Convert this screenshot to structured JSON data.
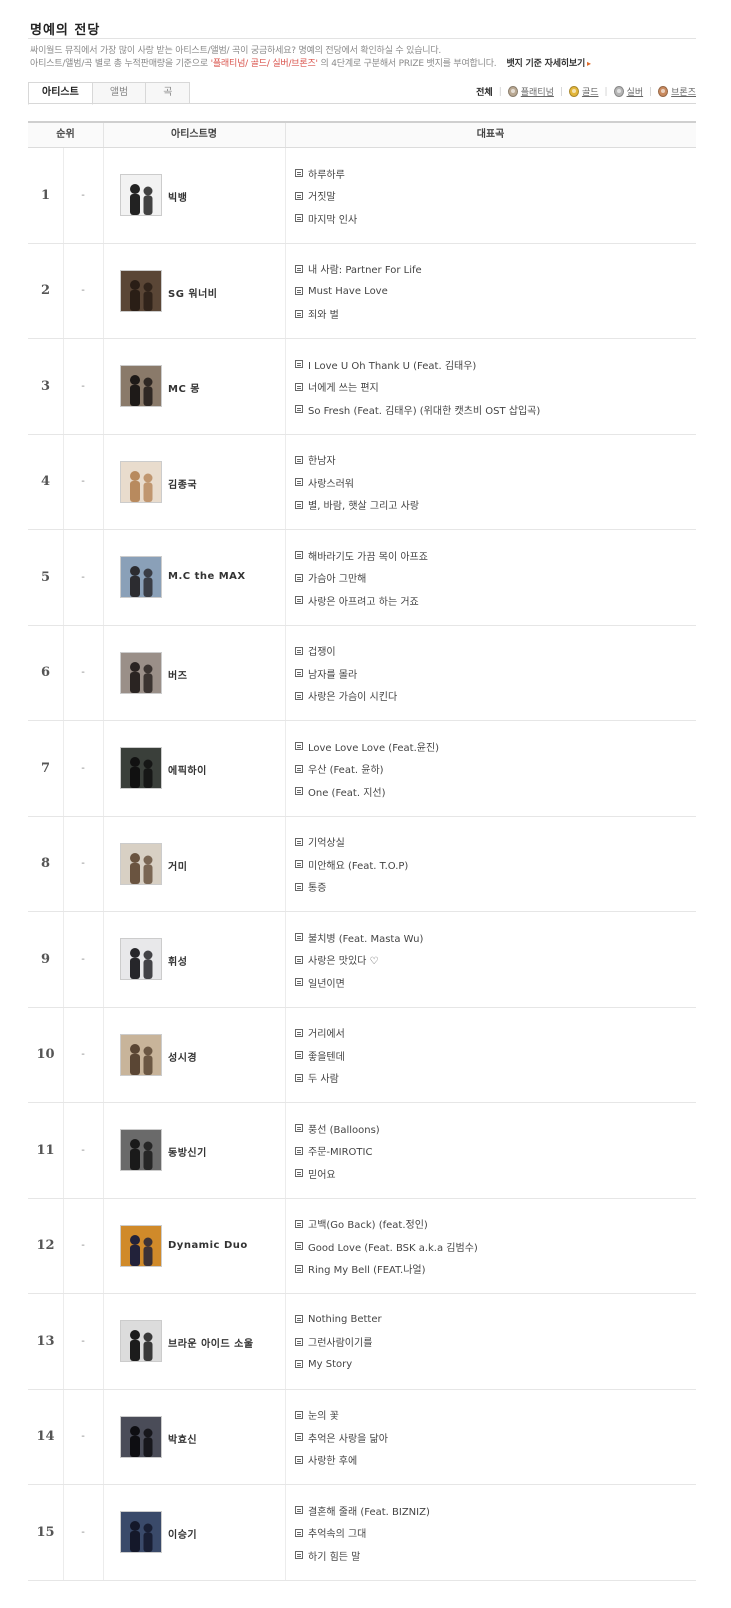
{
  "page": {
    "title": "명예의 전당",
    "desc_line1": "싸이월드 뮤직에서 가장 많이 사랑 받는 아티스트/앨범/ 곡이 궁금하세요? 명예의 전당에서 확인하실 수 있습니다.",
    "desc_line2_a": "아티스트/앨범/곡 별로 총 누적판매량을 기준으로 ",
    "desc_line2_hl": "'플래티넘/ 골드/ 실버/브론즈'",
    "desc_line2_b": " 의 4단계로 구분해서 PRIZE 뱃지를 부여합니다.",
    "badge_link": "뱃지 기준 자세히보기",
    "badge_link_arrow": "▸"
  },
  "tabs": [
    {
      "label": "아티스트",
      "active": true
    },
    {
      "label": "앨범",
      "active": false
    },
    {
      "label": "곡",
      "active": false
    }
  ],
  "filters": {
    "all": "전체",
    "platinum": "플래티넘",
    "gold": "골드",
    "silver": "실버",
    "bronze": "브론즈",
    "colors": {
      "platinum": "#b9a892",
      "gold": "#e3b63a",
      "silver": "#b5b5b5",
      "bronze": "#c98a5e"
    }
  },
  "table": {
    "headers": {
      "rank": "순위",
      "artist": "아티스트명",
      "songs": "대표곡"
    },
    "rows": [
      {
        "rank": "1",
        "change": "-",
        "artist": "빅뱅",
        "songs": [
          "하루하루",
          "거짓말",
          "마지막 인사"
        ],
        "photo": {
          "bg": "#f2f2f2",
          "fg": "#222222"
        }
      },
      {
        "rank": "2",
        "change": "-",
        "artist": "SG 워너비",
        "songs": [
          "내 사람: Partner For Life",
          "Must Have Love",
          "죄와 벌"
        ],
        "photo": {
          "bg": "#5a4636",
          "fg": "#2a1e16"
        }
      },
      {
        "rank": "3",
        "change": "-",
        "artist": "MC 몽",
        "songs": [
          "I Love U Oh Thank U (Feat. 김태우)",
          "너에게 쓰는 편지",
          "So Fresh (Feat. 김태우) (위대한 캣츠비 OST 삽입곡)"
        ],
        "photo": {
          "bg": "#8a7a6a",
          "fg": "#1e1a18"
        }
      },
      {
        "rank": "4",
        "change": "-",
        "artist": "김종국",
        "songs": [
          "한남자",
          "사랑스러워",
          "별, 바람, 햇살 그리고 사랑"
        ],
        "photo": {
          "bg": "#e9dccd",
          "fg": "#b88a5e"
        }
      },
      {
        "rank": "5",
        "change": "-",
        "artist": "M.C the MAX",
        "songs": [
          "해바라기도 가끔 목이 아프죠",
          "가슴아 그만해",
          "사랑은 아프려고 하는 거죠"
        ],
        "photo": {
          "bg": "#8aa0b8",
          "fg": "#2c2c30"
        }
      },
      {
        "rank": "6",
        "change": "-",
        "artist": "버즈",
        "songs": [
          "겁쟁이",
          "남자를 몰라",
          "사랑은 가슴이 시킨다"
        ],
        "photo": {
          "bg": "#9a8f88",
          "fg": "#2a2422"
        }
      },
      {
        "rank": "7",
        "change": "-",
        "artist": "에픽하이",
        "songs": [
          "Love Love Love (Feat.윤진)",
          "우산 (Feat. 윤하)",
          "One (Feat. 지선)"
        ],
        "photo": {
          "bg": "#3a3f3a",
          "fg": "#111111"
        }
      },
      {
        "rank": "8",
        "change": "-",
        "artist": "거미",
        "songs": [
          "기억상실",
          "미안해요 (Feat. T.O.P)",
          "통증"
        ],
        "photo": {
          "bg": "#d8d0c4",
          "fg": "#6a5440"
        }
      },
      {
        "rank": "9",
        "change": "-",
        "artist": "휘성",
        "songs": [
          "불치병 (Feat. Masta Wu)",
          "사랑은 맛있다 ♡",
          "일년이면"
        ],
        "photo": {
          "bg": "#e8e8ea",
          "fg": "#26262a"
        }
      },
      {
        "rank": "10",
        "change": "-",
        "artist": "성시경",
        "songs": [
          "거리에서",
          "좋을텐데",
          "두 사람"
        ],
        "photo": {
          "bg": "#c8b49a",
          "fg": "#5a4634"
        }
      },
      {
        "rank": "11",
        "change": "-",
        "artist": "동방신기",
        "songs": [
          "풍선 (Balloons)",
          "주문-MIROTIC",
          "믿어요"
        ],
        "photo": {
          "bg": "#6a6a6a",
          "fg": "#1a1a1a"
        }
      },
      {
        "rank": "12",
        "change": "-",
        "artist": "Dynamic Duo",
        "songs": [
          "고백(Go Back) (feat.정인)",
          "Good Love (Feat. BSK a.k.a 김범수)",
          "Ring My Bell (FEAT.나얼)"
        ],
        "photo": {
          "bg": "#d08a2a",
          "fg": "#22223a"
        }
      },
      {
        "rank": "13",
        "change": "-",
        "artist": "브라운 아이드 소울",
        "songs": [
          "Nothing Better",
          "그런사람이기를",
          "My Story"
        ],
        "photo": {
          "bg": "#dcdcdc",
          "fg": "#1c1c1c"
        }
      },
      {
        "rank": "14",
        "change": "-",
        "artist": "박효신",
        "songs": [
          "눈의 꽃",
          "추억은 사랑을 닮아",
          "사랑한 후에"
        ],
        "photo": {
          "bg": "#4a4c58",
          "fg": "#0e0e12"
        }
      },
      {
        "rank": "15",
        "change": "-",
        "artist": "이승기",
        "songs": [
          "결혼해 줄래 (Feat. BIZNIZ)",
          "추억속의 그대",
          "하기 힘든 말"
        ],
        "photo": {
          "bg": "#3a4a6a",
          "fg": "#14182a"
        }
      }
    ]
  }
}
